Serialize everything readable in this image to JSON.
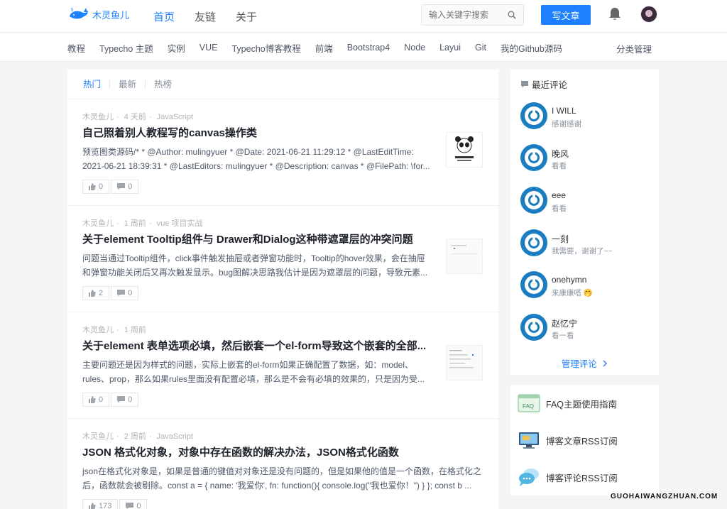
{
  "header": {
    "logo_text": "木灵鱼儿",
    "nav": [
      {
        "label": "首页",
        "active": true
      },
      {
        "label": "友链",
        "active": false
      },
      {
        "label": "关于",
        "active": false
      }
    ],
    "search_placeholder": "输入关键字搜索",
    "write_label": "写文章"
  },
  "categories": [
    "教程",
    "Typecho 主题",
    "实例",
    "VUE",
    "Typecho博客教程",
    "前端",
    "Bootstrap4",
    "Node",
    "Layui",
    "Git",
    "我的Github源码"
  ],
  "category_manage": "分类管理",
  "tabs": [
    {
      "label": "热门",
      "active": true
    },
    {
      "label": "最新",
      "active": false
    },
    {
      "label": "热榜",
      "active": false
    }
  ],
  "articles": [
    {
      "author": "木灵鱼儿",
      "time": "4 天前",
      "category": "JavaScript",
      "title": "自己照着别人教程写的canvas操作类",
      "excerpt": "预览图类源码/* * @Author: mulingyuer * @Date: 2021-06-21 11:29:12 * @LastEditTime: 2021-06-21 18:39:31 * @LastEditors: mulingyuer * @Description: canvas * @FilePath: \\for...",
      "likes": "0",
      "comments": "0"
    },
    {
      "author": "木灵鱼儿",
      "time": "1 周前",
      "category": "vue 项目实战",
      "title": "关于element Tooltip组件与 Drawer和Dialog这种带遮罩层的冲突问题",
      "excerpt": "问题当通过Tooltip组件，click事件触发抽屉或者弹窗功能时，Tooltip的hover效果，会在抽屉和弹窗功能关闭后又再次触发显示。bug图解决思路我估计是因为遮罩层的问题，导致元素...",
      "likes": "2",
      "comments": "0"
    },
    {
      "author": "木灵鱼儿",
      "time": "1 周前",
      "category": "",
      "title": "关于element 表单选项必填，然后嵌套一个el-form导致这个嵌套的全部...",
      "excerpt": "主要问题还是因为样式的问题，实际上嵌套的el-form如果正确配置了数据，如：model、rules、prop，那么如果rules里面没有配置必填，那么是不会有必填的效果的，只是因为受...",
      "likes": "0",
      "comments": "0"
    },
    {
      "author": "木灵鱼儿",
      "time": "2 周前",
      "category": "JavaScript",
      "title": "JSON 格式化对象，对象中存在函数的解决办法，JSON格式化函数",
      "excerpt": "json在格式化对象是，如果是普通的键值对对象还是没有问题的，但是如果他的值是一个函数，在格式化之后，函数就会被剔除。const a = { name: '我爱你', fn: function(){ console.log(\"我也爱你！\") } }; const b ...",
      "likes": "173",
      "comments": "0"
    }
  ],
  "sidebar": {
    "title": "最近评论",
    "comments": [
      {
        "name": "I WILL",
        "text": "感谢感谢"
      },
      {
        "name": "晚风",
        "text": "看看"
      },
      {
        "name": "eee",
        "text": "看看"
      },
      {
        "name": "一刻",
        "text": "我需要，谢谢了~~"
      },
      {
        "name": "onehymn",
        "text": "来康康嗒 🤭"
      },
      {
        "name": "赵忆宁",
        "text": "看一看"
      }
    ],
    "manage_label": "管理评论",
    "links": [
      {
        "label": "FAQ主题使用指南",
        "icon": "faq-icon"
      },
      {
        "label": "博客文章RSS订阅",
        "icon": "monitor-icon"
      },
      {
        "label": "博客评论RSS订阅",
        "icon": "chat-bubble-icon"
      }
    ]
  },
  "watermark": "GUOHAIWANGZHUAN.COM"
}
